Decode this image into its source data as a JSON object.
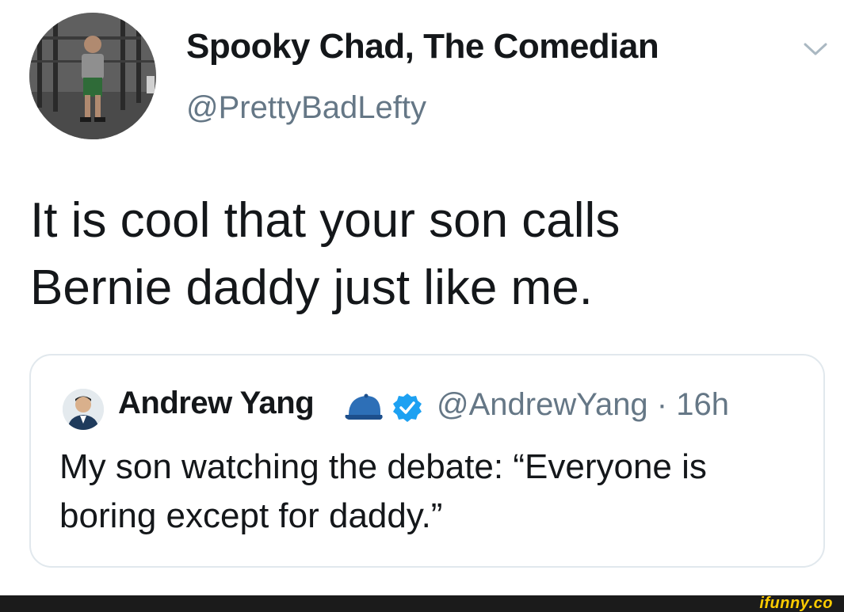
{
  "tweet": {
    "display_name": "Spooky Chad, The Comedian",
    "handle": "@PrettyBadLefty",
    "text_line1": "It is cool that your son calls",
    "text_line2": "Bernie daddy just like me.",
    "menu_icon": "chevron-down-icon"
  },
  "quoted_tweet": {
    "author_name": "Andrew Yang",
    "emoji_icon": "blue-cap-icon",
    "verified_icon": "verified-badge-icon",
    "meta": "@AndrewYang · 16h",
    "text_line1": "My son watching the debate: “Everyone is",
    "text_line2": "boring except for daddy.”"
  },
  "watermark": {
    "text": "ifunny.co"
  },
  "colors": {
    "text": "#14171a",
    "secondary": "#657786",
    "verified": "#1da1f2",
    "border": "#e1e8ed",
    "watermark": "#ffcc00"
  }
}
